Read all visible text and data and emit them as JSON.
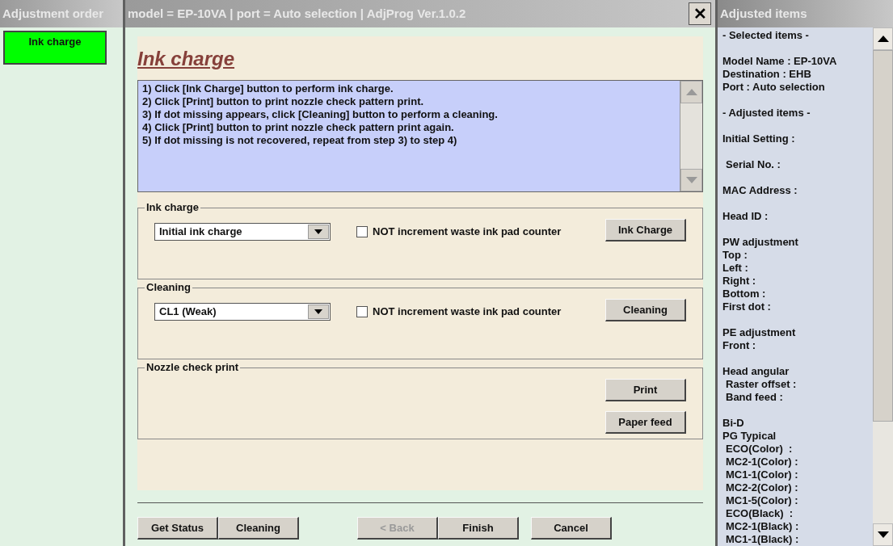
{
  "left_panel": {
    "title": "Adjustment order",
    "items": [
      {
        "label": "Ink charge",
        "selected": true
      }
    ]
  },
  "window": {
    "title": "model = EP-10VA | port = Auto selection | AdjProg Ver.1.0.2",
    "close": "✕"
  },
  "page_title": "Ink charge",
  "instructions": [
    "1) Click [Ink Charge] button to perform ink charge.",
    "2) Click [Print] button to print nozzle check pattern print.",
    "3) If dot missing appears, click [Cleaning] button to perform a cleaning.",
    "4) Click [Print] button to print nozzle check pattern print again.",
    "5) If dot missing is not recovered, repeat from step 3) to step 4)"
  ],
  "groups": [
    {
      "title": "Ink charge",
      "dropdown": "Initial ink charge",
      "checkbox": {
        "label": "NOT increment waste ink pad counter",
        "checked": false
      },
      "buttons": [
        "Ink Charge"
      ]
    },
    {
      "title": "Cleaning",
      "dropdown": "CL1 (Weak)",
      "checkbox": {
        "label": "NOT increment waste ink pad counter",
        "checked": false
      },
      "buttons": [
        "Cleaning"
      ]
    },
    {
      "title": "Nozzle check print",
      "buttons": [
        "Print",
        "Paper feed"
      ]
    }
  ],
  "footer_button_groups": [
    [
      {
        "label": "Get Status",
        "disabled": false
      },
      {
        "label": "Cleaning",
        "disabled": false
      }
    ],
    [
      {
        "label": "< Back",
        "disabled": true
      },
      {
        "label": "Finish",
        "disabled": false
      }
    ],
    [
      {
        "label": "Cancel",
        "disabled": false
      }
    ]
  ],
  "right_panel": {
    "title": "Adjusted items",
    "groups": [
      [
        {
          "text": "- Selected items -",
          "kind": "heading"
        }
      ],
      [
        {
          "text": "Model Name : EP-10VA",
          "kind": "plain"
        },
        {
          "text": "Destination : EHB",
          "kind": "plain"
        },
        {
          "text": "Port : Auto selection",
          "kind": "plain"
        }
      ],
      [
        {
          "text": "- Adjusted items -",
          "kind": "heading"
        }
      ],
      [
        {
          "text": "Initial Setting :",
          "kind": "plain"
        }
      ],
      [
        {
          "text": "Serial No. :",
          "kind": "indented"
        }
      ],
      [
        {
          "text": "MAC Address :",
          "kind": "plain"
        }
      ],
      [
        {
          "text": "Head ID :",
          "kind": "plain"
        }
      ],
      [
        {
          "text": "PW adjustment",
          "kind": "plain"
        },
        {
          "text": "Top :",
          "kind": "plain"
        },
        {
          "text": "Left :",
          "kind": "plain"
        },
        {
          "text": "Right :",
          "kind": "plain"
        },
        {
          "text": "Bottom :",
          "kind": "plain"
        },
        {
          "text": "First dot :",
          "kind": "plain"
        }
      ],
      [
        {
          "text": "PE adjustment",
          "kind": "plain"
        },
        {
          "text": "Front :",
          "kind": "plain"
        }
      ],
      [
        {
          "text": "Head angular",
          "kind": "plain"
        },
        {
          "text": "Raster offset :",
          "kind": "indented"
        },
        {
          "text": "Band feed :",
          "kind": "indented"
        }
      ],
      [
        {
          "text": "Bi-D",
          "kind": "plain"
        },
        {
          "text": "PG Typical",
          "kind": "plain"
        },
        {
          "text": "ECO(Color)  :",
          "kind": "indented"
        },
        {
          "text": "MC2-1(Color) :",
          "kind": "indented"
        },
        {
          "text": "MC1-1(Color) :",
          "kind": "indented"
        },
        {
          "text": "MC2-2(Color) :",
          "kind": "indented"
        },
        {
          "text": "MC1-5(Color) :",
          "kind": "indented"
        },
        {
          "text": "ECO(Black)  :",
          "kind": "indented"
        },
        {
          "text": "MC2-1(Black) :",
          "kind": "indented"
        },
        {
          "text": "MC1-1(Black) :",
          "kind": "indented"
        }
      ]
    ]
  }
}
